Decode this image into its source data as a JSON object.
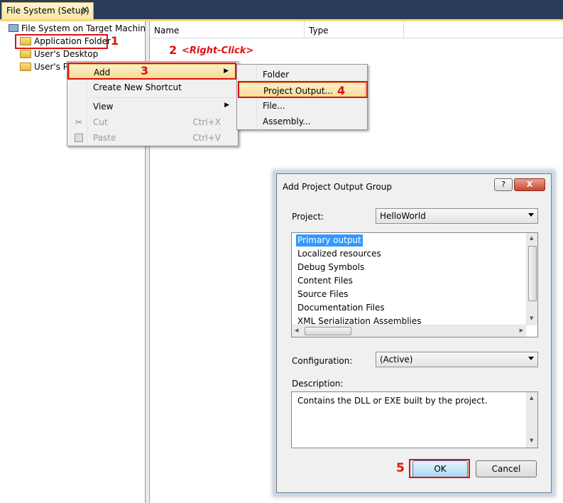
{
  "tab": {
    "title": "File System (Setup)",
    "close": "✕"
  },
  "tree": {
    "root": "File System on Target Machine",
    "items": [
      "Application Folder",
      "User's Desktop",
      "User's Pr"
    ]
  },
  "list_headers": {
    "name": "Name",
    "type": "Type"
  },
  "annotations": {
    "n1": "1",
    "n2": "2",
    "right_click": "<Right-Click>",
    "n3": "3",
    "n4": "4",
    "n5": "5"
  },
  "context_menu": {
    "add": "Add",
    "create_shortcut": "Create New Shortcut",
    "view": "View",
    "cut": "Cut",
    "cut_shortcut": "Ctrl+X",
    "paste": "Paste",
    "paste_shortcut": "Ctrl+V"
  },
  "submenu": {
    "folder": "Folder",
    "project_output": "Project Output...",
    "file": "File...",
    "assembly": "Assembly..."
  },
  "dialog": {
    "title": "Add Project Output Group",
    "help": "?",
    "close": "X",
    "project_label": "Project:",
    "project_value": "HelloWorld",
    "outputs": [
      "Primary output",
      "Localized resources",
      "Debug Symbols",
      "Content Files",
      "Source Files",
      "Documentation Files",
      "XML Serialization Assemblies"
    ],
    "configuration_label": "Configuration:",
    "configuration_value": "(Active)",
    "description_label": "Description:",
    "description_text": "Contains the DLL or EXE built by the project.",
    "ok": "OK",
    "cancel": "Cancel"
  },
  "colors": {
    "annotation": "#dd1111",
    "selection": "#3399ff",
    "tab_bar": "#2b3c5a"
  }
}
